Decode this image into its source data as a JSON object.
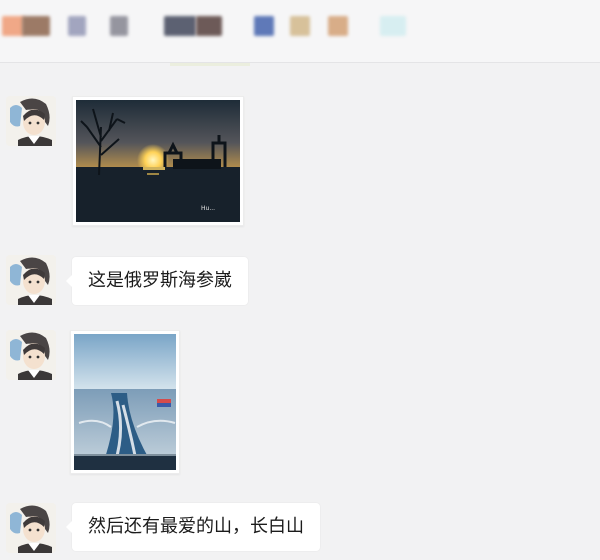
{
  "header": {
    "blocks": [
      {
        "color": "#f0a887"
      },
      {
        "color": "#9c7a66"
      },
      {
        "color": "#7f84a8"
      },
      {
        "color": "#7e7e8a"
      },
      {
        "color": "#5c6172"
      },
      {
        "color": "#6d5a58"
      },
      {
        "color": "#5f79b8"
      },
      {
        "color": "#d7c19a"
      },
      {
        "color": "#d8ad88"
      },
      {
        "color": "#d7eef1"
      }
    ]
  },
  "messages": [
    {
      "type": "image",
      "image": "sunset-harbor-photo",
      "caption": "Hu..."
    },
    {
      "type": "text",
      "text": "这是俄罗斯海参崴"
    },
    {
      "type": "image",
      "image": "sea-wake-photo"
    },
    {
      "type": "text",
      "text": "然后还有最爱的山，长白山"
    }
  ]
}
